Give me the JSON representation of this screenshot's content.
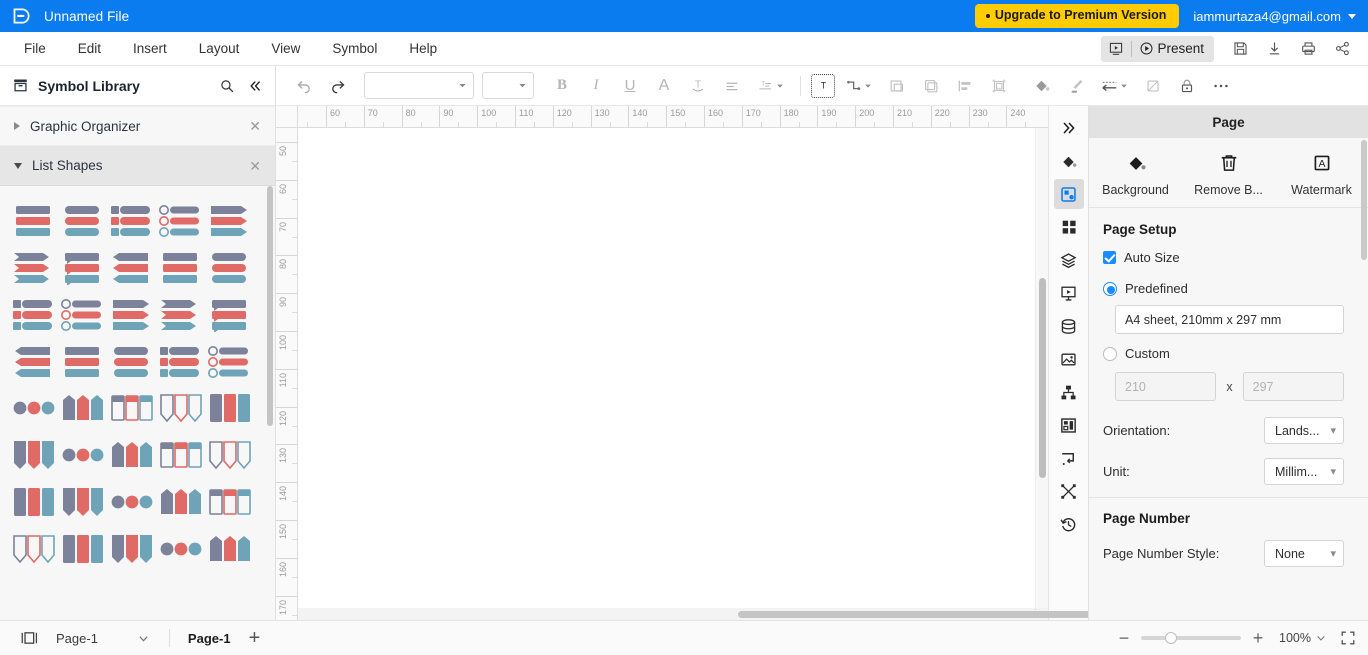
{
  "titlebar": {
    "logo_icon": "wondershare-edrawmax-logo-icon",
    "file_name": "Unnamed File",
    "upgrade_label": "Upgrade to Premium Version",
    "account_email": "iammurtaza4@gmail.com",
    "bg_color": "#0a7cf0",
    "upgrade_color": "#ffcc00"
  },
  "menubar": {
    "items": [
      {
        "label": "File",
        "name": "menu-file"
      },
      {
        "label": "Edit",
        "name": "menu-edit"
      },
      {
        "label": "Insert",
        "name": "menu-insert"
      },
      {
        "label": "Layout",
        "name": "menu-layout"
      },
      {
        "label": "View",
        "name": "menu-view"
      },
      {
        "label": "Symbol",
        "name": "menu-symbol"
      },
      {
        "label": "Help",
        "name": "menu-help"
      }
    ],
    "present_label": "Present",
    "right_icons": [
      "slideshow-icon",
      "save-icon",
      "download-icon",
      "print-icon",
      "share-icon"
    ]
  },
  "toolbar": {
    "undo_icon": "undo-icon",
    "redo_icon": "redo-icon",
    "font_family_value": "",
    "font_size_value": "",
    "bold_label": "B",
    "italic_label": "I",
    "underline_label": "U",
    "font_color_label": "A",
    "text_style_label": "T",
    "icons": [
      "align-left-icon",
      "line-spacing-icon",
      "text-box-icon",
      "connector-icon",
      "group-icon",
      "duplicate-icon",
      "align-objects-icon",
      "select-all-icon",
      "fill-color-icon",
      "line-color-icon",
      "line-style-icon",
      "shadow-icon",
      "lock-icon",
      "more-options-icon"
    ]
  },
  "sidebar": {
    "title": "Symbol Library",
    "library_icon": "library-icon",
    "search_icon": "search-icon",
    "collapse_icon": "collapse-left-icon",
    "sections": [
      {
        "label": "Graphic Organizer",
        "expanded": false,
        "name": "library-section-graphic-organizer"
      },
      {
        "label": "List Shapes",
        "expanded": true,
        "name": "library-section-list-shapes"
      }
    ],
    "shape_count": 40,
    "palette": {
      "slate": "#7b8299",
      "red": "#e06a65",
      "blue": "#6fa3b8",
      "gold": "#d8ad4a",
      "navy": "#5d6b91"
    }
  },
  "canvas": {
    "h_ruler_start": 55,
    "h_ruler_end": 245,
    "h_ruler_labels": [
      60,
      70,
      80,
      90,
      100,
      110,
      120,
      130,
      140,
      150,
      160,
      170,
      180,
      190,
      200,
      210,
      220,
      230,
      240
    ],
    "v_ruler_labels": [
      50,
      60,
      70,
      80,
      90,
      100,
      110,
      120,
      130,
      140,
      150,
      160,
      170
    ],
    "page_background": "#ffffff"
  },
  "rail": {
    "icons": [
      {
        "name": "expand-panel-icon",
        "glyph": "chevrons-right",
        "active": false
      },
      {
        "name": "fill-style-icon",
        "glyph": "paint-bucket",
        "active": false
      },
      {
        "name": "page-settings-icon",
        "glyph": "page-gear",
        "active": true
      },
      {
        "name": "shape-library-icon",
        "glyph": "grid-squares",
        "active": false
      },
      {
        "name": "layers-icon",
        "glyph": "layers",
        "active": false
      },
      {
        "name": "presentation-icon",
        "glyph": "presentation",
        "active": false
      },
      {
        "name": "data-icon",
        "glyph": "database",
        "active": false
      },
      {
        "name": "image-icon",
        "glyph": "picture",
        "active": false
      },
      {
        "name": "org-chart-icon",
        "glyph": "hierarchy",
        "active": false
      },
      {
        "name": "floorplan-icon",
        "glyph": "floorplan",
        "active": false
      },
      {
        "name": "connector-settings-icon",
        "glyph": "connector",
        "active": false
      },
      {
        "name": "distribute-icon",
        "glyph": "distribute",
        "active": false
      },
      {
        "name": "history-icon",
        "glyph": "history",
        "active": false
      }
    ]
  },
  "right_panel": {
    "header": "Page",
    "tools": [
      {
        "label": "Background",
        "icon": "paint-bucket-icon",
        "name": "background-tool"
      },
      {
        "label": "Remove B...",
        "icon": "trash-icon",
        "name": "remove-background-tool"
      },
      {
        "label": "Watermark",
        "icon": "watermark-icon",
        "name": "watermark-tool"
      }
    ],
    "page_setup": {
      "title": "Page Setup",
      "auto_size_label": "Auto Size",
      "auto_size_checked": true,
      "predefined_label": "Predefined",
      "predefined_selected": true,
      "predefined_value": "A4 sheet, 210mm x 297 mm",
      "custom_label": "Custom",
      "custom_selected": false,
      "custom_width_placeholder": "210",
      "custom_height_placeholder": "297",
      "custom_separator": "x",
      "orientation_label": "Orientation:",
      "orientation_value": "Lands...",
      "unit_label": "Unit:",
      "unit_value": "Millim..."
    },
    "page_number": {
      "title": "Page Number",
      "style_label": "Page Number Style:",
      "style_value": "None"
    }
  },
  "statusbar": {
    "layout_icon": "page-layout-icon",
    "page_selector_value": "Page-1",
    "active_tab": "Page-1",
    "add_tab_label": "+",
    "zoom_out_label": "−",
    "zoom_in_label": "+",
    "zoom_value": "100%",
    "fullscreen_icon": "fullscreen-icon"
  }
}
